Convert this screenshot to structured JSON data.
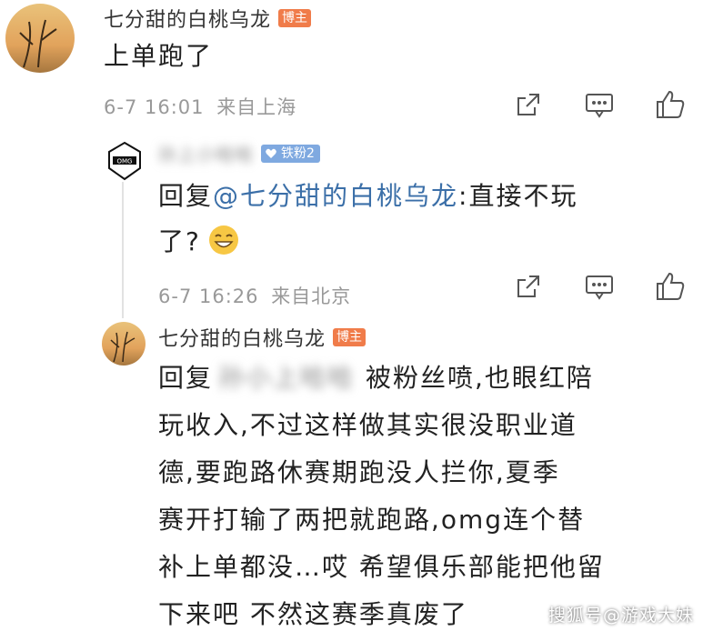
{
  "comments": [
    {
      "username": "七分甜的白桃乌龙",
      "badge": "博主",
      "text": "上单跑了",
      "date": "6-7 16:01",
      "location": "来自上海"
    },
    {
      "username_blurred": "孙上小哈哈",
      "fan_badge": "铁粉2",
      "reply_prefix": "回复",
      "mention": "@七分甜的白桃乌龙",
      "text_line1": ":直接不玩",
      "text_line2": "了?",
      "emoji": "laugh-emoji",
      "date": "6-7 16:26",
      "location": "来自北京"
    },
    {
      "username": "七分甜的白桃乌龙",
      "badge": "博主",
      "reply_prefix": "回复",
      "blurred_name": "孙小上哈哈",
      "lines": [
        "被粉丝喷,也眼红陪",
        "玩收入,不过这样做其实很没职业道",
        "德,要跑路休赛期跑没人拦你,夏季",
        "赛开打输了两把就跑路,omg连个替",
        "补上单都没…哎 希望俱乐部能把他留",
        "下来吧 不然这赛季真废了"
      ]
    }
  ],
  "watermark": "搜狐号@游戏大妹",
  "colors": {
    "badge": "#f07c4a",
    "mention": "#3b6fa8",
    "meta": "#999999"
  }
}
